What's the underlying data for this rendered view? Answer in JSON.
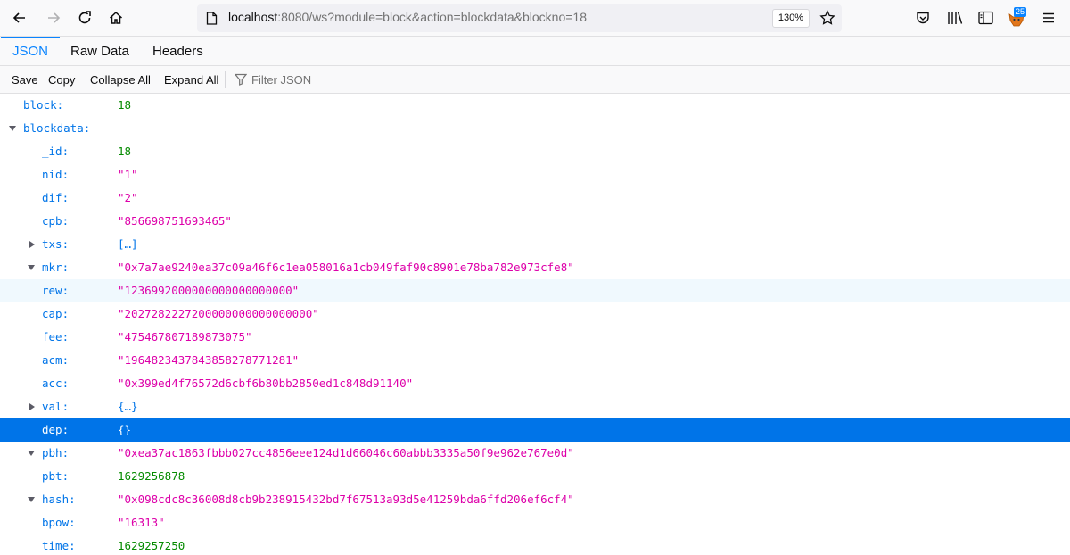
{
  "browser": {
    "url_host": "localhost",
    "url_rest": ":8080/ws?module=block&action=blockdata&blockno=18",
    "zoom": "130%",
    "extension_badge": "25"
  },
  "tabs": [
    "JSON",
    "Raw Data",
    "Headers"
  ],
  "toolbar": {
    "save": "Save",
    "copy": "Copy",
    "collapse_all": "Collapse All",
    "expand_all": "Expand All",
    "filter_placeholder": "Filter JSON"
  },
  "tree": {
    "block": {
      "key": "block:",
      "value": "18"
    },
    "blockdata": {
      "key": "blockdata:"
    },
    "id": {
      "key": "_id:",
      "value": "18"
    },
    "nid": {
      "key": "nid:",
      "value": "\"1\""
    },
    "dif": {
      "key": "dif:",
      "value": "\"2\""
    },
    "cpb": {
      "key": "cpb:",
      "value": "\"856698751693465\""
    },
    "txs": {
      "key": "txs:",
      "value": "[…]"
    },
    "mkr": {
      "key": "mkr:",
      "value": "\"0x7a7ae9240ea37c09a46f6c1ea058016a1cb049faf90c8901e78ba782e973cfe8\""
    },
    "rew": {
      "key": "rew:",
      "value": "\"1236992000000000000000000\""
    },
    "cap": {
      "key": "cap:",
      "value": "\"2027282227200000000000000000\""
    },
    "fee": {
      "key": "fee:",
      "value": "\"475467807189873075\""
    },
    "acm": {
      "key": "acm:",
      "value": "\"1964823437843858278771281\""
    },
    "acc": {
      "key": "acc:",
      "value": "\"0x399ed4f76572d6cbf6b80bb2850ed1c848d91140\""
    },
    "val": {
      "key": "val:",
      "value": "{…}"
    },
    "dep": {
      "key": "dep:",
      "value": "{}"
    },
    "pbh": {
      "key": "pbh:",
      "value": "\"0xea37ac1863fbbb027cc4856eee124d1d66046c60abbb3335a50f9e962e767e0d\""
    },
    "pbt": {
      "key": "pbt:",
      "value": "1629256878"
    },
    "hash": {
      "key": "hash:",
      "value": "\"0x098cdc8c36008d8cb9b238915432bd7f67513a93d5e41259bda6ffd206ef6cf4\""
    },
    "bpow": {
      "key": "bpow:",
      "value": "\"16313\""
    },
    "time": {
      "key": "time:",
      "value": "1629257250"
    }
  }
}
